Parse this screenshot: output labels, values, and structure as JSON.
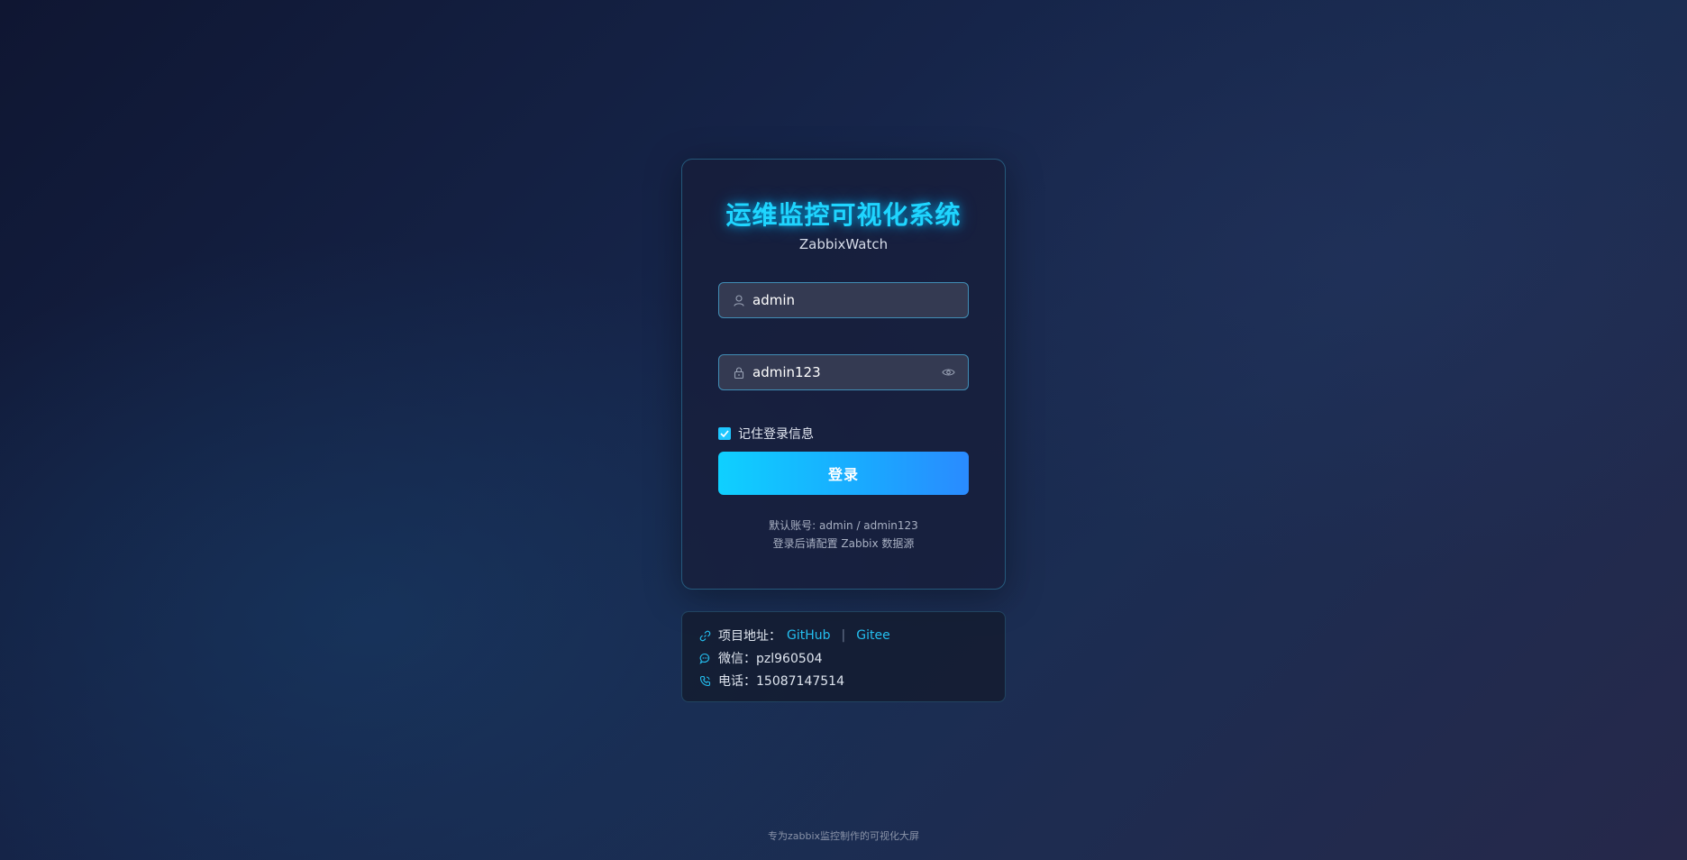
{
  "login": {
    "title": "运维监控可视化系统",
    "subtitle": "ZabbixWatch",
    "username": {
      "value": "admin",
      "icon": "user-icon"
    },
    "password": {
      "value": "admin123",
      "icon": "lock-icon",
      "toggle_icon": "eye-icon"
    },
    "remember": {
      "label": "记住登录信息",
      "checked": true
    },
    "submit_label": "登录",
    "hint_account": "默认账号: admin / admin123",
    "hint_config": "登录后请配置 Zabbix 数据源"
  },
  "info": {
    "project_label": "项目地址：",
    "github_label": "GitHub",
    "separator": "|",
    "gitee_label": "Gitee",
    "wechat": "微信：pzl960504",
    "phone": "电话：15087147514"
  },
  "footer": "专为zabbix监控制作的可视化大屏",
  "colors": {
    "accent": "#1fd5ff",
    "button_start": "#0fd0ff",
    "button_end": "#2a8bff",
    "link": "#24bff0"
  }
}
